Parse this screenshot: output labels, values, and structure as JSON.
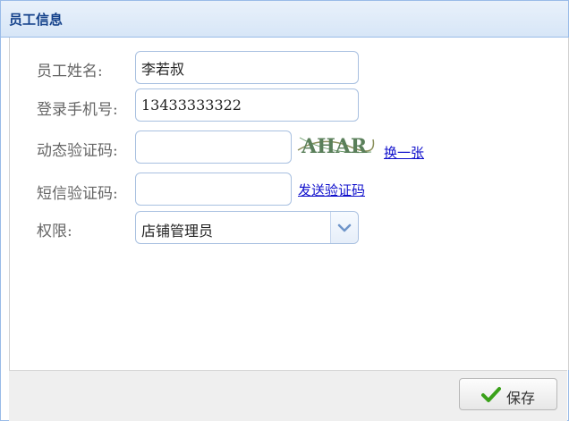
{
  "window": {
    "title": "员工信息"
  },
  "form": {
    "name_label": "员工姓名:",
    "name_value": "李若叔",
    "phone_label": "登录手机号:",
    "phone_value": "13433333322",
    "captcha_label": "动态验证码:",
    "captcha_value": "",
    "captcha_image_text": "AHAR",
    "refresh_captcha_link": "换一张",
    "sms_label": "短信验证码:",
    "sms_value": "",
    "send_code_link": "发送验证码",
    "role_label": "权限:",
    "role_selected": "店铺管理员"
  },
  "footer": {
    "save_label": "保存"
  },
  "icons": {
    "save": "check-icon",
    "dropdown": "chevron-down-icon"
  },
  "colors": {
    "title": "#15428b",
    "link": "#1010cc",
    "check": "#3aa11a"
  }
}
